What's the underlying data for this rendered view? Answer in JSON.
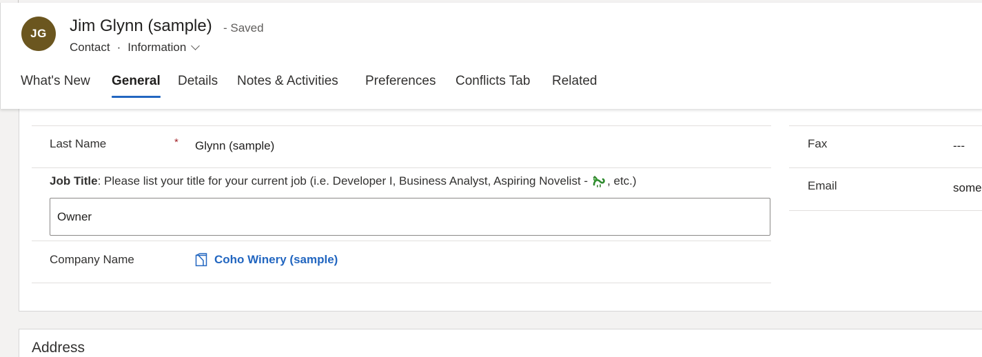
{
  "record": {
    "avatar_initials": "JG",
    "title": "Jim Glynn (sample)",
    "save_status": "- Saved",
    "entity": "Contact",
    "separator": "·",
    "form_name": "Information"
  },
  "tabs": [
    {
      "label": "What's New",
      "active": false
    },
    {
      "label": "General",
      "active": true
    },
    {
      "label": "Details",
      "active": false
    },
    {
      "label": "Notes & Activities",
      "active": false
    },
    {
      "label": "Preferences",
      "active": false
    },
    {
      "label": "Conflicts Tab",
      "active": false
    },
    {
      "label": "Related",
      "active": false
    }
  ],
  "fields": {
    "last_name": {
      "label": "Last Name",
      "required_marker": "*",
      "value": "Glynn (sample)"
    },
    "job_title": {
      "label": "Job Title",
      "hint_before": ": Please list your title for your current job (i.e. Developer I, Business Analyst, Aspiring Novelist - ",
      "hint_after": ", etc.)",
      "emoji_icon": "dragon-icon",
      "value": "Owner"
    },
    "company_name": {
      "label": "Company Name",
      "value": "Coho Winery (sample)",
      "icon": "record-link-icon"
    },
    "fax": {
      "label": "Fax",
      "value": "---"
    },
    "email": {
      "label": "Email",
      "value": "some"
    }
  },
  "sections": {
    "address_title": "Address"
  },
  "colors": {
    "avatar_bg": "#6b561f",
    "accent": "#2266c0",
    "required": "#a4262c"
  }
}
